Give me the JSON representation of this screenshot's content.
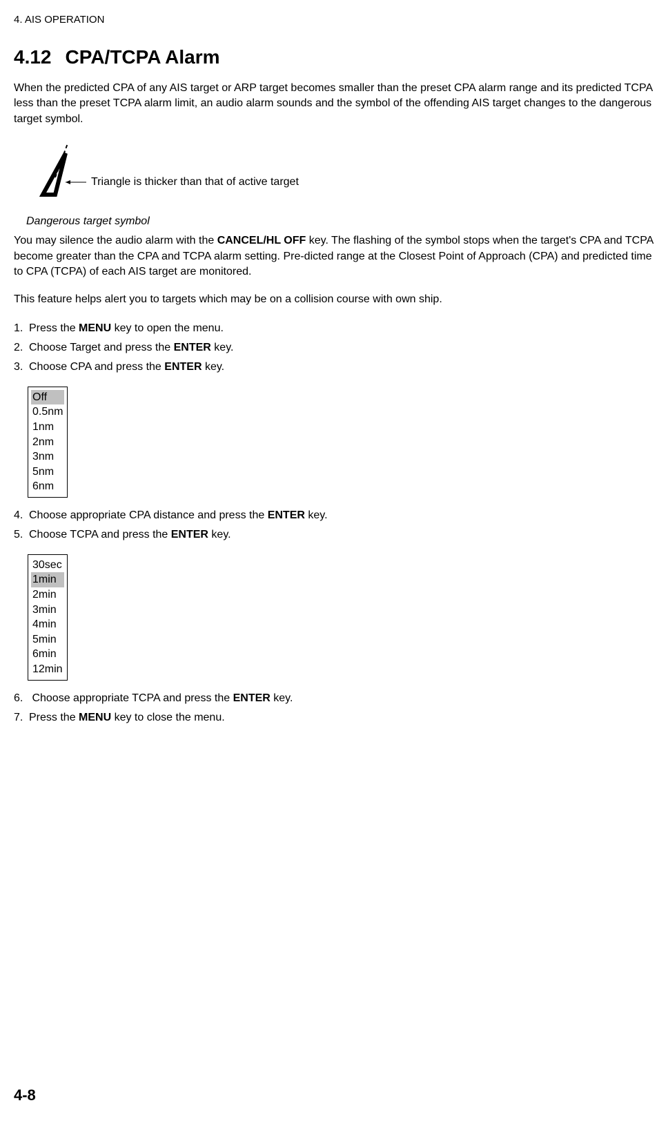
{
  "header": "4. AIS OPERATION",
  "section": {
    "number": "4.12",
    "title": "CPA/TCPA Alarm"
  },
  "para1": "When the predicted CPA of any AIS target or ARP target becomes smaller than the preset CPA alarm range and its predicted TCPA less than the preset TCPA alarm limit, an audio alarm sounds and the symbol of the offending AIS target changes to the dangerous target symbol.",
  "symbolLabel": "Triangle is thicker than that of active target",
  "symbolCaption": "Dangerous target symbol",
  "para2_prefix": "You may silence the audio alarm with the ",
  "para2_key": "CANCEL/HL OFF",
  "para2_suffix": " key. The flashing of the symbol stops when the target's CPA and TCPA become greater than the CPA and TCPA alarm setting. Pre-dicted range at the Closest Point of Approach (CPA) and predicted time to CPA (TCPA) of each AIS target are monitored.",
  "para3": "This feature helps alert you to targets which may be on a collision course with own ship.",
  "steps": {
    "s1_prefix": "Press the ",
    "s1_key": "MENU",
    "s1_suffix": " key to open the menu.",
    "s2_prefix": "Choose Target and press the ",
    "s2_key": "ENTER",
    "s2_suffix": " key.",
    "s3_prefix": "Choose CPA and press the ",
    "s3_key": "ENTER",
    "s3_suffix": " key.",
    "s4_prefix": "Choose appropriate CPA distance and press the ",
    "s4_key": "ENTER",
    "s4_suffix": " key.",
    "s5_prefix": "Choose TCPA and press the ",
    "s5_key": "ENTER",
    "s5_suffix": " key.",
    "s6_prefix": " Choose appropriate TCPA and press the ",
    "s6_key": "ENTER",
    "s6_suffix": " key.",
    "s7_prefix": "Press the ",
    "s7_key": "MENU",
    "s7_suffix": " key to close the menu."
  },
  "cpaOptions": [
    "Off",
    "0.5nm",
    "1nm",
    "2nm",
    "3nm",
    "5nm",
    "6nm"
  ],
  "cpaSelectedIndex": 0,
  "tcpaOptions": [
    "30sec",
    "1min",
    "2min",
    "3min",
    "4min",
    "5min",
    "6min",
    "12min"
  ],
  "tcpaSelectedIndex": 1,
  "pageNumber": "4-8"
}
